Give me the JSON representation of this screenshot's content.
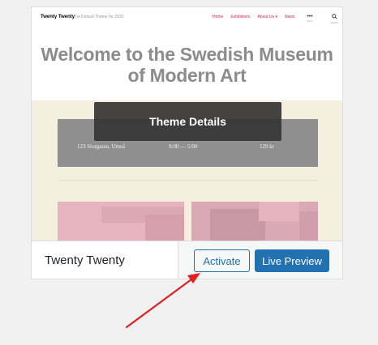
{
  "theme_card": {
    "screenshot": {
      "site_title": "Twenty Twenty",
      "site_description": "The Default Theme for 2020",
      "nav_items": [
        "Home",
        "Exhibitions",
        "About Us ▾",
        "News"
      ],
      "menu_icon_caption": "Menu",
      "search_icon_caption": "Search",
      "hero_title": "Welcome to the Swedish Museum of Modern Art",
      "info": {
        "address": "123 Storgatan, Umeå",
        "hours": "9:00 — 5:00",
        "price": "129 kr"
      }
    },
    "overlay_label": "Theme Details",
    "theme_name": "Twenty Twenty",
    "activate_label": "Activate",
    "live_preview_label": "Live Preview"
  },
  "colors": {
    "accent_blue": "#2271b1",
    "annotation_arrow": "#e0201f",
    "theme_accent": "#cd2653"
  }
}
